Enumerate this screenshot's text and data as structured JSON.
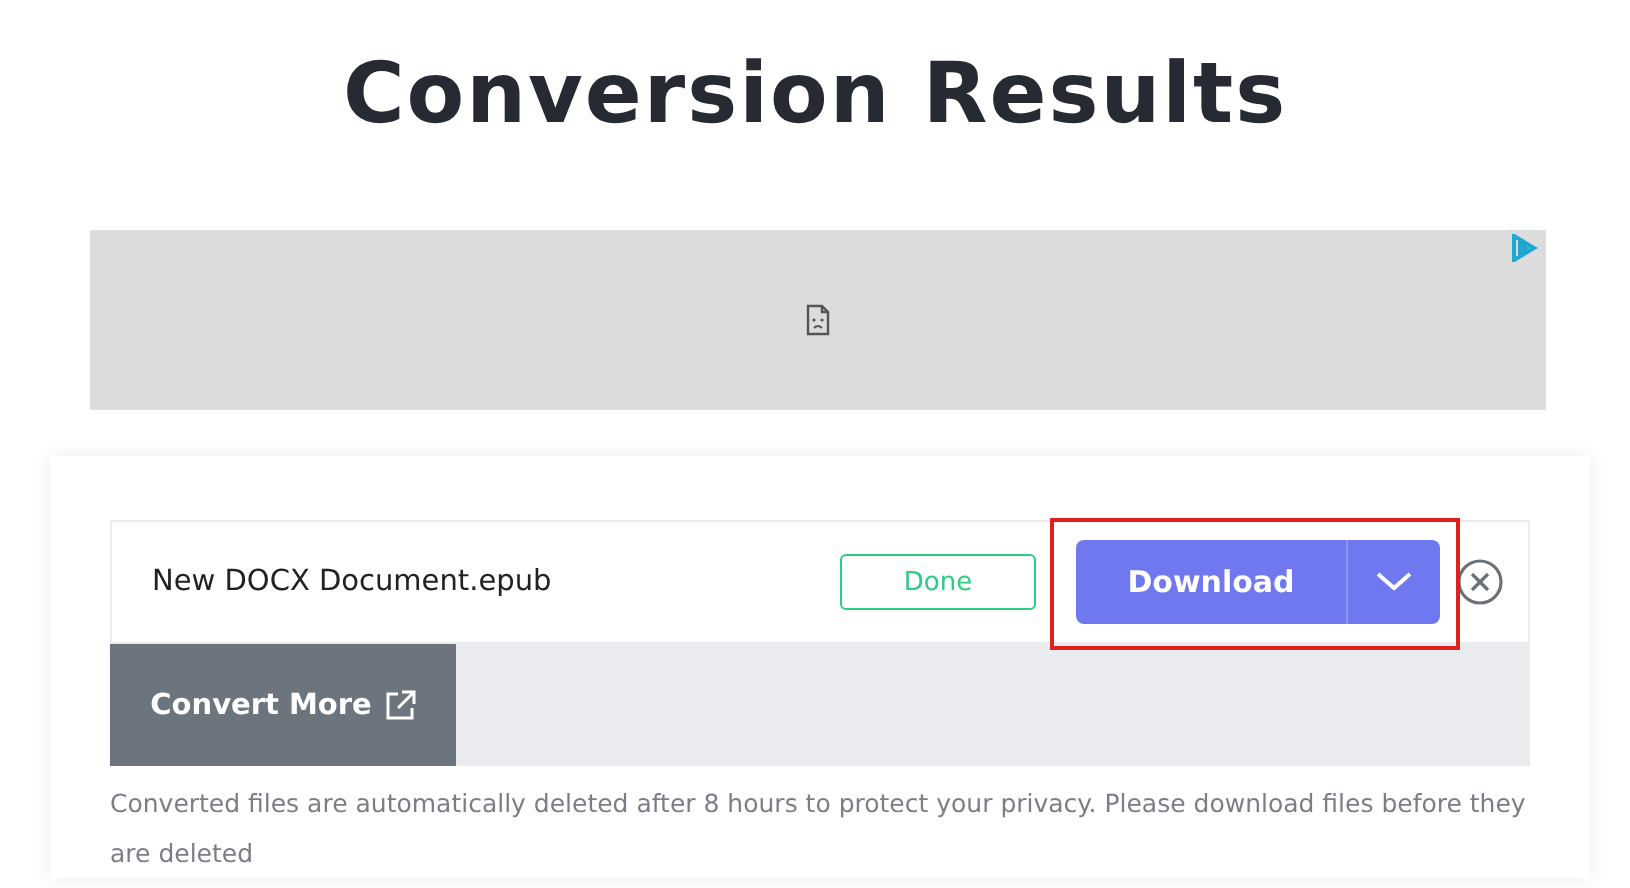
{
  "title": "Conversion Results",
  "file": {
    "name": "New DOCX Document.epub",
    "status": "Done",
    "download_label": "Download",
    "download_highlighted": true
  },
  "convert_more": {
    "label": "Convert More"
  },
  "note": "Converted files are automatically deleted after 8 hours to protect your privacy. Please download files before they are deleted"
}
